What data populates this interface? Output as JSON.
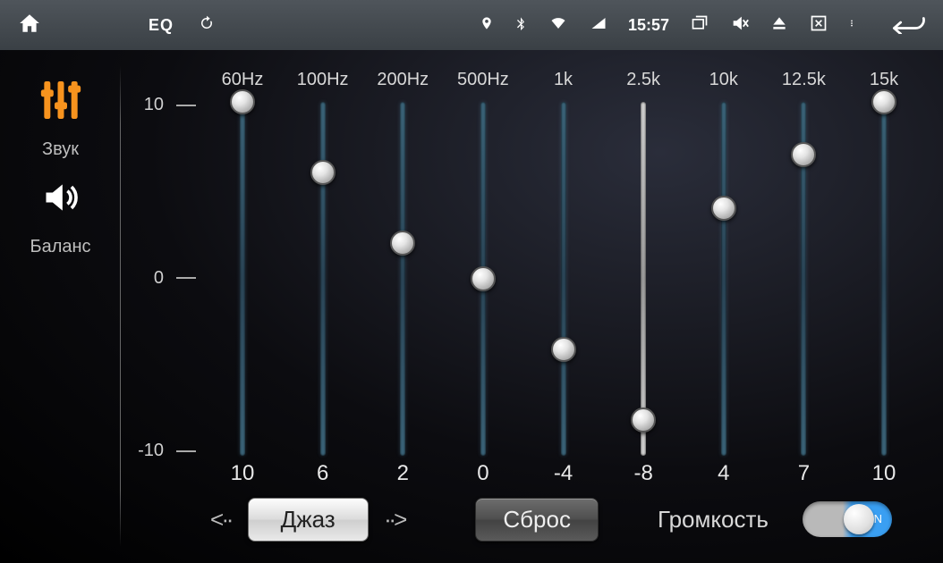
{
  "topbar": {
    "eq_label": "EQ",
    "time": "15:57"
  },
  "sidebar": {
    "sound_label": "Звук",
    "balance_label": "Баланс"
  },
  "eq": {
    "scale": {
      "max": "10",
      "mid": "0",
      "min": "-10"
    },
    "range": {
      "min": -10,
      "max": 10
    },
    "bands": [
      {
        "freq": "60Hz",
        "value": 10,
        "value_text": "10"
      },
      {
        "freq": "100Hz",
        "value": 6,
        "value_text": "6"
      },
      {
        "freq": "200Hz",
        "value": 2,
        "value_text": "2"
      },
      {
        "freq": "500Hz",
        "value": 0,
        "value_text": "0"
      },
      {
        "freq": "1k",
        "value": -4,
        "value_text": "-4"
      },
      {
        "freq": "2.5k",
        "value": -8,
        "value_text": "-8"
      },
      {
        "freq": "10k",
        "value": 4,
        "value_text": "4"
      },
      {
        "freq": "12.5k",
        "value": 7,
        "value_text": "7"
      },
      {
        "freq": "15k",
        "value": 10,
        "value_text": "10"
      }
    ]
  },
  "controls": {
    "preset_label": "Джаз",
    "reset_label": "Сброс",
    "volume_label": "Громкость",
    "toggle_on_text": "ON",
    "volume_on": true
  }
}
